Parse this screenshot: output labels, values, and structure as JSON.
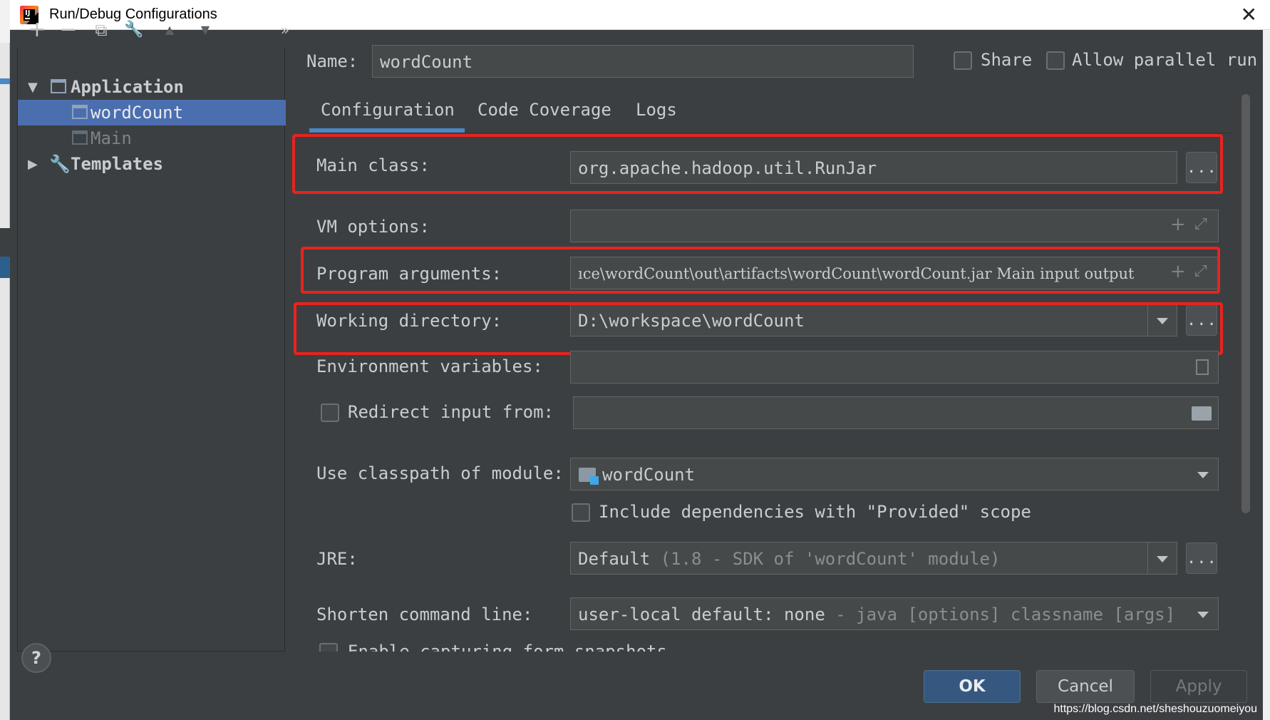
{
  "window": {
    "title": "Run/Debug Configurations",
    "close": "✕"
  },
  "toolbar": {
    "add": "+",
    "remove": "−",
    "copy": "⧉",
    "edit": "🔧",
    "up": "▲",
    "down": "▼",
    "more": "»"
  },
  "tree": {
    "application_label": "Application",
    "items": [
      "wordCount",
      "Main"
    ],
    "templates_label": "Templates",
    "expanded_arrow": "▼",
    "collapsed_arrow": "▶"
  },
  "name_row": {
    "label": "Name:",
    "value": "wordCount",
    "share_label": "Share",
    "parallel_label": "Allow parallel run"
  },
  "tabs": [
    "Configuration",
    "Code Coverage",
    "Logs"
  ],
  "form": {
    "main_class_label": "Main class:",
    "main_class_value": "org.apache.hadoop.util.RunJar",
    "vm_options_label": "VM options:",
    "program_args_label": "Program arguments:",
    "program_args_value": "ıce\\wordCount\\out\\artifacts\\wordCount\\wordCount.jar Main input output",
    "working_dir_label": "Working directory:",
    "working_dir_value": "D:\\workspace\\wordCount",
    "env_vars_label": "Environment variables:",
    "redirect_label": "Redirect input from:",
    "classpath_label": "Use classpath of module:",
    "classpath_value": "wordCount",
    "include_deps_label": "Include dependencies with \"Provided\" scope",
    "jre_label": "JRE:",
    "jre_value_default": "Default",
    "jre_value_detail": "(1.8 - SDK of 'wordCount' module)",
    "shorten_label": "Shorten command line:",
    "shorten_value_main": "user-local default: none",
    "shorten_value_detail": "- java [options] classname [args]",
    "capture_label": "Enable capturing form snapshots",
    "browse": "...",
    "plus": "+",
    "expand": "⤢"
  },
  "buttons": {
    "ok": "OK",
    "cancel": "Cancel",
    "apply": "Apply",
    "help": "?"
  },
  "watermark": "https://blog.csdn.net/sheshouzuomeiyou",
  "colors": {
    "background": "#3c3f41",
    "selection": "#4b6eaf",
    "highlight": "#e8231f",
    "accent": "#4a88c7"
  }
}
